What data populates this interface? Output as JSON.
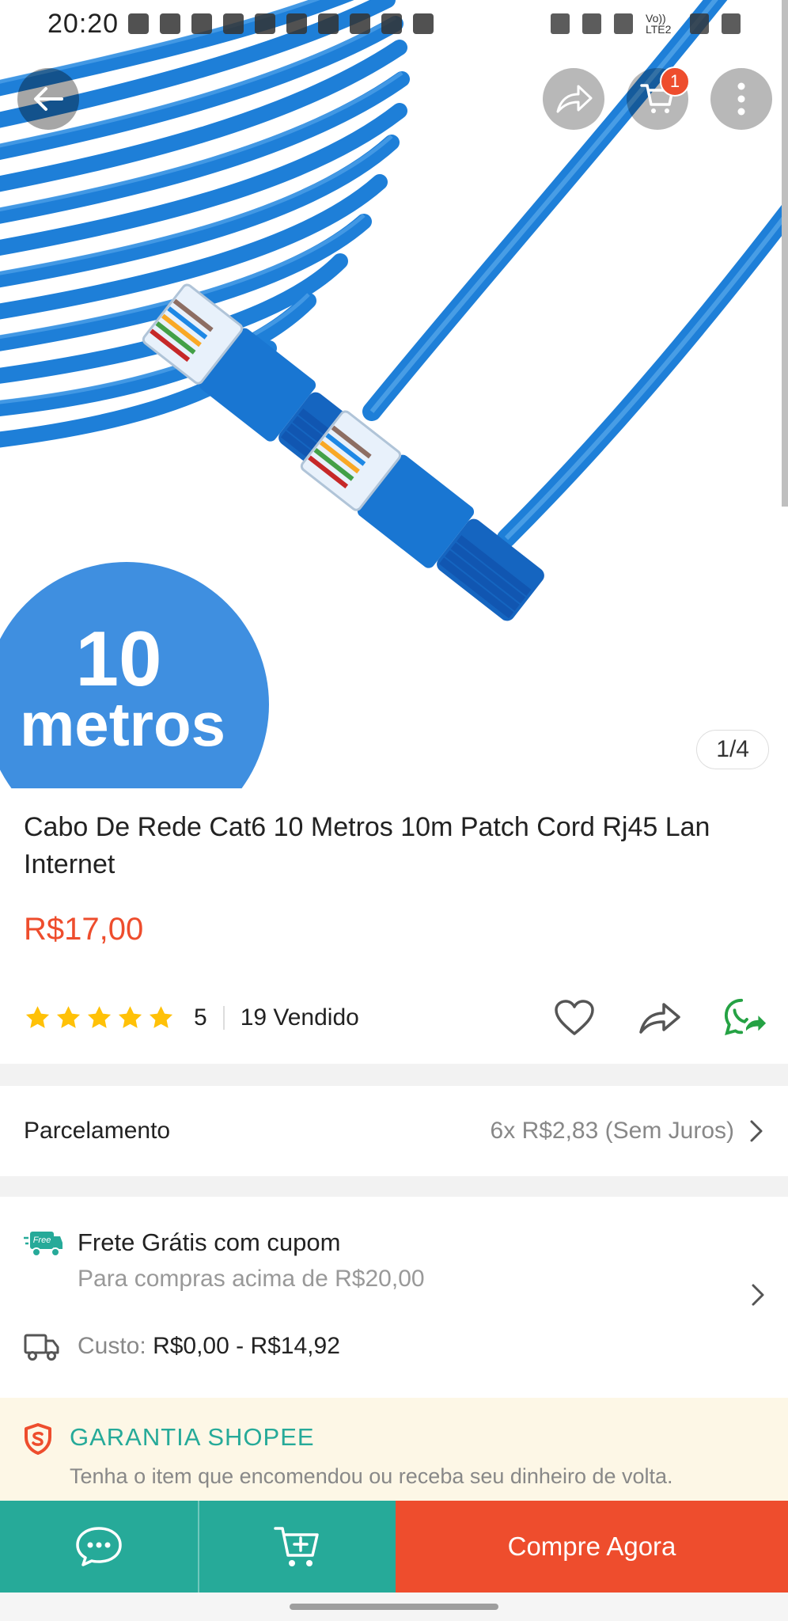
{
  "status_bar": {
    "time": "20:20",
    "network_label": "Vo)) LTE2"
  },
  "header": {
    "cart_badge": "1",
    "icons": [
      "back-arrow-icon",
      "share-icon",
      "cart-icon",
      "more-vertical-icon"
    ]
  },
  "gallery": {
    "counter": "1/4",
    "image_text_line1": "10",
    "image_text_line2": "metros",
    "badge_color": "#3f8fe0",
    "cable_color": "#1e7fd8"
  },
  "product": {
    "title": "Cabo De Rede Cat6 10 Metros 10m Patch Cord Rj45 Lan Internet",
    "price": "R$17,00",
    "rating": "5",
    "sold": "19 Vendido",
    "star_count": 5
  },
  "installment": {
    "label": "Parcelamento",
    "value": "6x R$2,83 (Sem Juros)"
  },
  "shipping": {
    "free_badge": "Free",
    "title": "Frete Grátis com cupom",
    "subtitle": "Para compras acima de R$20,00",
    "cost_label": "Custo:",
    "cost_value": "R$0,00 - R$14,92"
  },
  "guarantee": {
    "title": "GARANTIA SHOPEE",
    "subtitle": "Tenha o item que encomendou ou receba seu dinheiro de volta."
  },
  "bottom_bar": {
    "buy_label": "Compre Agora"
  },
  "colors": {
    "brand_orange": "#ee4d2d",
    "teal": "#26aa99",
    "star": "#ffc107",
    "whatsapp": "#25a244"
  }
}
